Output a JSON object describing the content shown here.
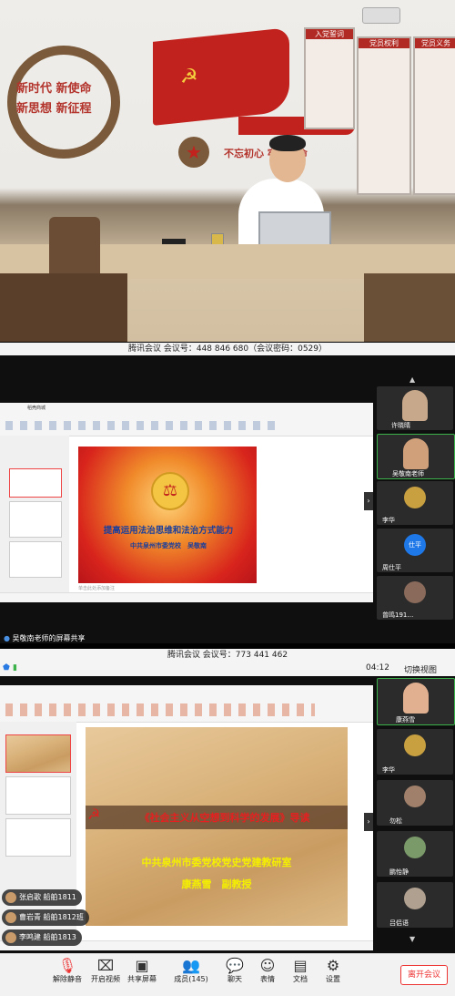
{
  "panel1": {
    "wall_slogan_line1": "新时代 新使命",
    "wall_slogan_line2": "新思想 新征程",
    "oath_board_title": "入党誓词",
    "rights_board_title": "党员权利",
    "duties_board_title": "党员义务",
    "banner_text": "不忘初心 牢记使命"
  },
  "panel2": {
    "meeting_bar": "腾讯会议 会议号：448 846 680（会议密码：0529）",
    "wps_tab": "稻壳商城",
    "slide_title": "提高运用法治思维和法治方式能力",
    "slide_subtitle": "中共泉州市委党校　吴敬南",
    "notes_placeholder": "单击此处添加备注",
    "participants": [
      {
        "name": "许晓晴"
      },
      {
        "name": "吴敬南老师"
      },
      {
        "name": "李华"
      },
      {
        "name": "周仕平",
        "avatar_text": "仕平"
      },
      {
        "name": "曾鸣191…"
      }
    ],
    "share_status": "吴敬南老师的屏幕共享"
  },
  "panel3": {
    "meeting_bar": "腾讯会议 会议号：773 441 462",
    "timer": "04:12",
    "switch_view": "切换视图",
    "slide_title": "《社会主义从空想到科学的发展》导读",
    "slide_line2": "中共泉州市委党校党史党建教研室",
    "slide_line3": "康燕雪　副教授",
    "participants": [
      {
        "name": "康燕雪"
      },
      {
        "name": "李华"
      },
      {
        "name": "勿松"
      },
      {
        "name": "鹏怡静"
      },
      {
        "name": "吕侣语"
      }
    ],
    "chat": [
      {
        "text": "张启歌 船舶1811"
      },
      {
        "text": "曹岩青 船舶1812班"
      },
      {
        "text": "李鸣建 船舶1813"
      }
    ],
    "toolbar": [
      {
        "label": "解除静音",
        "icon": "microphone-muted-icon"
      },
      {
        "label": "开启视频",
        "icon": "camera-off-icon"
      },
      {
        "label": "共享屏幕",
        "icon": "screen-share-icon"
      },
      {
        "label": "成员(145)",
        "icon": "members-icon"
      },
      {
        "label": "聊天",
        "icon": "chat-icon"
      },
      {
        "label": "表情",
        "icon": "emoji-icon"
      },
      {
        "label": "文档",
        "icon": "document-icon"
      },
      {
        "label": "设置",
        "icon": "settings-icon"
      }
    ],
    "end_meeting": "离开会议"
  }
}
